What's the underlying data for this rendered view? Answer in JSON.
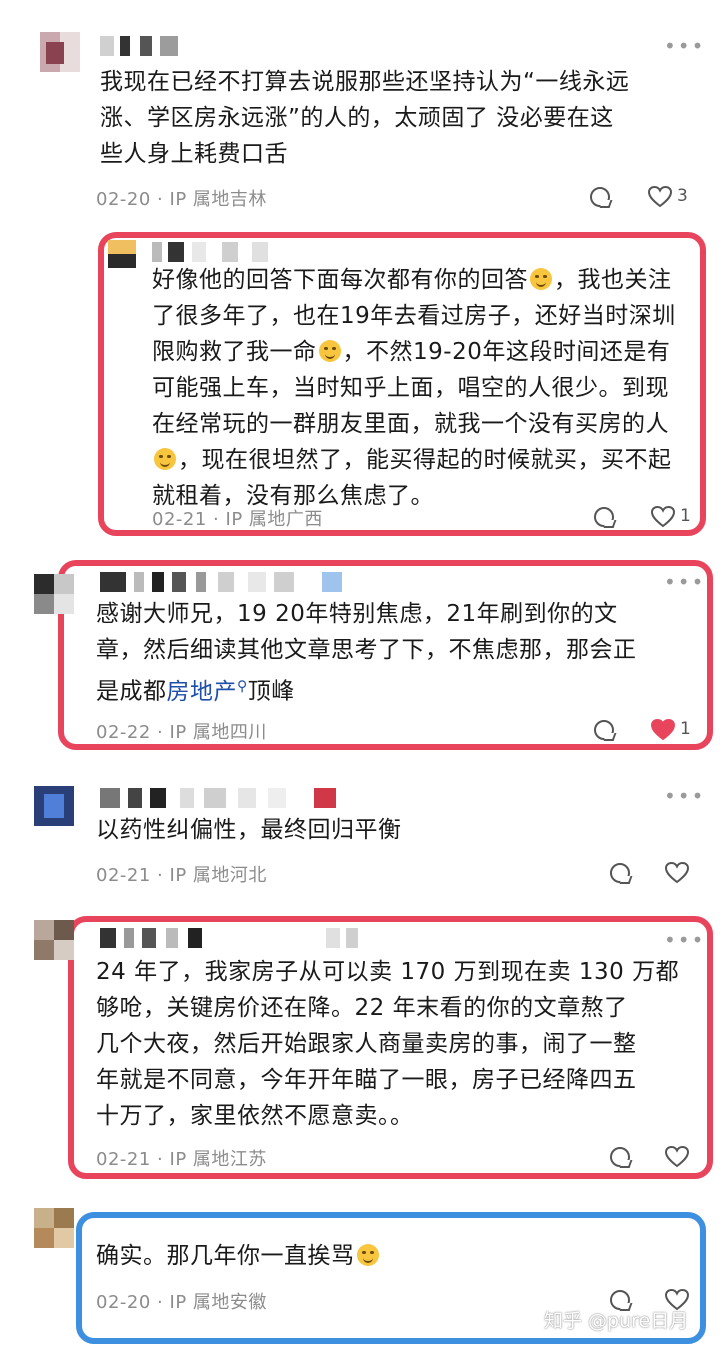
{
  "comments": [
    {
      "text": "我现在已经不打算去说服那些还坚持认为“一线永远涨、学区房永远涨”的人的，太顽固了 没必要在这些人身上耗费口舌",
      "lines": [
        "我现在已经不打算去说服那些还坚持认为“一线永远",
        "涨、学区房永远涨”的人的，太顽固了  没必要在这",
        "些人身上耗费口舌"
      ],
      "date": "02-20",
      "ip": "IP 属地吉林",
      "likes": "3"
    },
    {
      "lines": [
        "好像他的回答下面每次都有你的回答",
        "，我也关注",
        "了很多年了，也在19年去看过房子，还好当时深圳",
        "限购救了我一命",
        "，不然19-20年这段时间还是有",
        "可能强上车，当时知乎上面，唱空的人很少。到现",
        "在经常玩的一群朋友里面，就我一个没有买房的人",
        "，现在很坦然了，能买得起的时候就买，买不起",
        "就租着，没有那么焦虑了。"
      ],
      "date": "02-21",
      "ip": "IP 属地广西",
      "likes": "1"
    },
    {
      "line1": "感谢大师兄，19 20年特别焦虑，21年刷到你的文",
      "line2": "章，然后细读其他文章思考了下，不焦虑那，那会正",
      "line3_prefix": "是成都",
      "link": "房地产",
      "line3_suffix": "顶峰",
      "date": "02-22",
      "ip": "IP 属地四川",
      "likes": "1"
    },
    {
      "text": "以药性纠偏性，最终回归平衡",
      "date": "02-21",
      "ip": "IP 属地河北"
    },
    {
      "lines": [
        "24 年了，我家房子从可以卖 170 万到现在卖 130 万都",
        "够呛，关键房价还在降。22 年末看的你的文章熬了",
        "几个大夜，然后开始跟家人商量卖房的事，闹了一整",
        "年就是不同意，今年开年瞄了一眼，房子已经降四五",
        "十万了，家里依然不愿意卖。。"
      ],
      "date": "02-21",
      "ip": "IP 属地江苏"
    },
    {
      "text": "确实。那几年你一直挨骂",
      "date": "02-20",
      "ip": "IP 属地安徽"
    }
  ],
  "separator": "·",
  "more_glyph": "•••",
  "watermark": "知乎 @pure日月",
  "colors": {
    "highlight_red": "#e8455d",
    "highlight_blue": "#3d8fe0",
    "link": "#1f4fa8",
    "liked_heart": "#e8455d"
  }
}
